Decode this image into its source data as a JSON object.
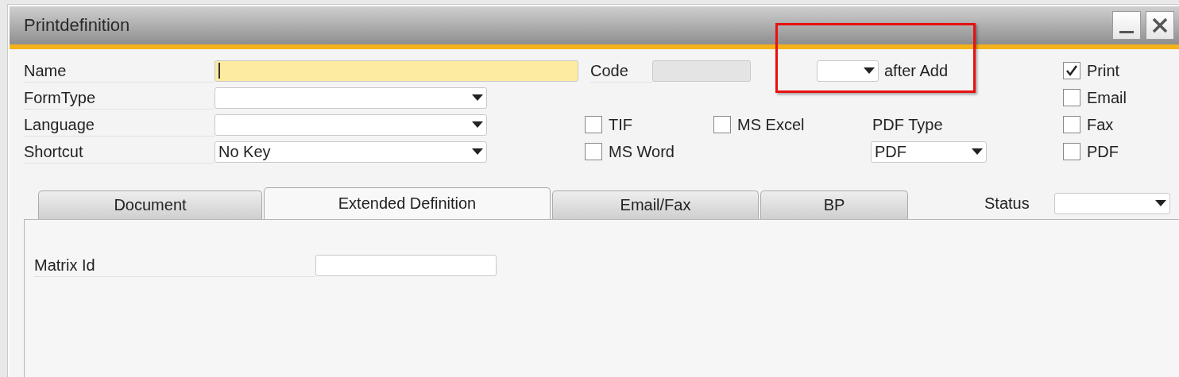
{
  "window": {
    "title": "Printdefinition"
  },
  "fields": [
    {
      "label": "Name",
      "kind": "text",
      "focused": true
    },
    {
      "label": "FormType",
      "kind": "combo"
    },
    {
      "label": "Language",
      "kind": "combo"
    },
    {
      "label": "Shortcut",
      "kind": "combo",
      "value": "No Key"
    }
  ],
  "code": {
    "label": "Code",
    "disabled": true
  },
  "after_add": {
    "label": "after Add"
  },
  "formats": [
    {
      "label": "TIF",
      "checked": false
    },
    {
      "label": "MS Excel",
      "checked": false
    },
    {
      "label": "MS Word",
      "checked": false
    }
  ],
  "pdf_type": {
    "label": "PDF Type",
    "value": "PDF"
  },
  "outputs": [
    {
      "label": "Print",
      "checked": true
    },
    {
      "label": "Email",
      "checked": false
    },
    {
      "label": "Fax",
      "checked": false
    },
    {
      "label": "PDF",
      "checked": false
    }
  ],
  "tabs": [
    {
      "label": "Document",
      "selected": false
    },
    {
      "label": "Extended Definition",
      "selected": true
    },
    {
      "label": "Email/Fax",
      "selected": false
    },
    {
      "label": "BP",
      "selected": false
    }
  ],
  "status": {
    "label": "Status"
  },
  "matrix": {
    "label": "Matrix Id"
  }
}
